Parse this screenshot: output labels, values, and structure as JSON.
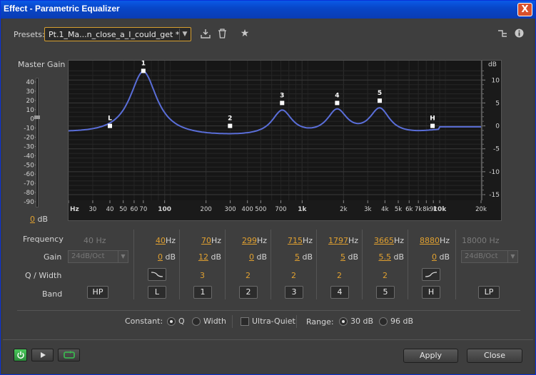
{
  "window": {
    "title": "Effect - Parametric Equalizer",
    "close_glyph": "X"
  },
  "presets": {
    "label": "Presets:",
    "value": "Pt.1_Ma...n_close_a_I_could_get *"
  },
  "master_gain": {
    "label": "Master Gain",
    "value": "0",
    "unit": "dB",
    "scale": [
      "40",
      "30",
      "20",
      "10",
      "0",
      "-10",
      "-20",
      "-30",
      "-40",
      "-50",
      "-60",
      "-70",
      "-80",
      "-90"
    ]
  },
  "graph": {
    "db_unit": "dB",
    "db_ticks": [
      "10",
      "5",
      "0",
      "-5",
      "-10",
      "-15"
    ],
    "freq_labels": [
      "Hz",
      "30",
      "40",
      "50",
      "60",
      "70",
      "100",
      "200",
      "300",
      "400",
      "500",
      "700",
      "1k",
      "2k",
      "3k",
      "4k",
      "5k",
      "6k",
      "7k",
      "8k",
      "9k",
      "10k",
      "20k"
    ],
    "bold_freq_labels": [
      "Hz",
      "100",
      "1k",
      "10k"
    ],
    "band_markers": [
      {
        "label": "L",
        "freq_hz": 40,
        "gain_db": 0
      },
      {
        "label": "1",
        "freq_hz": 70,
        "gain_db": 12
      },
      {
        "label": "2",
        "freq_hz": 299,
        "gain_db": 0
      },
      {
        "label": "3",
        "freq_hz": 715,
        "gain_db": 5
      },
      {
        "label": "4",
        "freq_hz": 1797,
        "gain_db": 5
      },
      {
        "label": "5",
        "freq_hz": 3665,
        "gain_db": 5.5
      },
      {
        "label": "H",
        "freq_hz": 8880,
        "gain_db": 0
      }
    ],
    "curve_color": "#5a6ed8"
  },
  "rows": {
    "frequency": "Frequency",
    "gain": "Gain",
    "q_width": "Q / Width",
    "band": "Band"
  },
  "units": {
    "hz": "Hz",
    "db": "dB"
  },
  "hp": {
    "freq": "40 Hz",
    "slope": "24dB/Oct",
    "button": "HP"
  },
  "lp": {
    "freq": "18000 Hz",
    "slope": "24dB/Oct",
    "button": "LP"
  },
  "bands": [
    {
      "id": "L",
      "freq": "40",
      "gain": "0",
      "q": "",
      "shape": "low-shelf"
    },
    {
      "id": "1",
      "freq": "70",
      "gain": "12",
      "q": "3"
    },
    {
      "id": "2",
      "freq": "299",
      "gain": "0",
      "q": "2"
    },
    {
      "id": "3",
      "freq": "715",
      "gain": "5",
      "q": "2"
    },
    {
      "id": "4",
      "freq": "1797",
      "gain": "5",
      "q": "2"
    },
    {
      "id": "5",
      "freq": "3665",
      "gain": "5.5",
      "q": "2"
    },
    {
      "id": "H",
      "freq": "8880",
      "gain": "0",
      "q": "",
      "shape": "high-shelf"
    }
  ],
  "options": {
    "constant": "Constant:",
    "q": "Q",
    "width": "Width",
    "ultra_quiet": "Ultra-Quiet",
    "range": "Range:",
    "range_30": "30 dB",
    "range_96": "96 dB",
    "constant_selected": "Q",
    "range_selected": "30 dB",
    "ultra_quiet_checked": false
  },
  "footer": {
    "apply": "Apply",
    "close": "Close"
  },
  "colors": {
    "accent": "#e0a030",
    "power_on": "#3cb450"
  }
}
